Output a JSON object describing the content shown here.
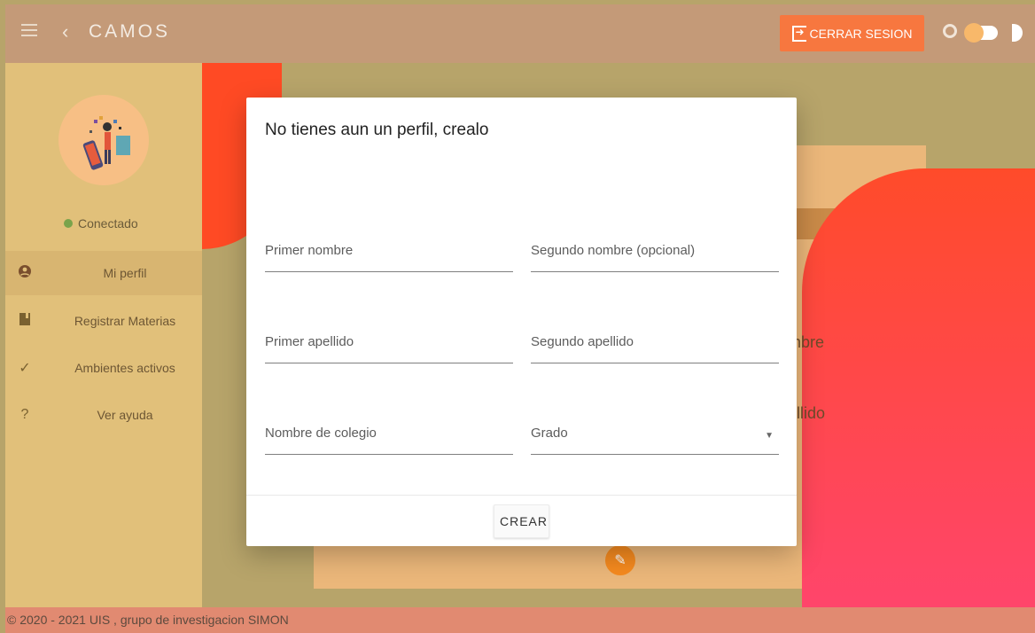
{
  "header": {
    "title": "CAMOS",
    "logout_label": "CERRAR SESION"
  },
  "sidebar": {
    "status": "Conectado",
    "items": [
      {
        "label": "Mi perfil",
        "icon": "user-circle-icon",
        "active": true
      },
      {
        "label": "Registrar Materias",
        "icon": "book-icon",
        "active": false
      },
      {
        "label": "Ambientes activos",
        "icon": "check-icon",
        "active": false
      },
      {
        "label": "Ver ayuda",
        "icon": "question-icon",
        "active": false
      }
    ]
  },
  "background_card": {
    "text1": "mbre",
    "text2": "ellido"
  },
  "modal": {
    "title": "No tienes aun un perfil, crealo",
    "fields": [
      {
        "label": "Primer nombre"
      },
      {
        "label": "Segundo nombre (opcional)"
      },
      {
        "label": "Primer apellido"
      },
      {
        "label": "Segundo apellido"
      },
      {
        "label": "Nombre de colegio"
      },
      {
        "label": "Grado"
      }
    ],
    "create_label": "CREAR"
  },
  "footer": {
    "text": "© 2020 - 2021 UIS , grupo de investigacion SIMON"
  },
  "colors": {
    "topbar": "#c49a78",
    "sidebar": "#e1c07a",
    "accent": "#f7773f",
    "footer": "#e18a71"
  }
}
